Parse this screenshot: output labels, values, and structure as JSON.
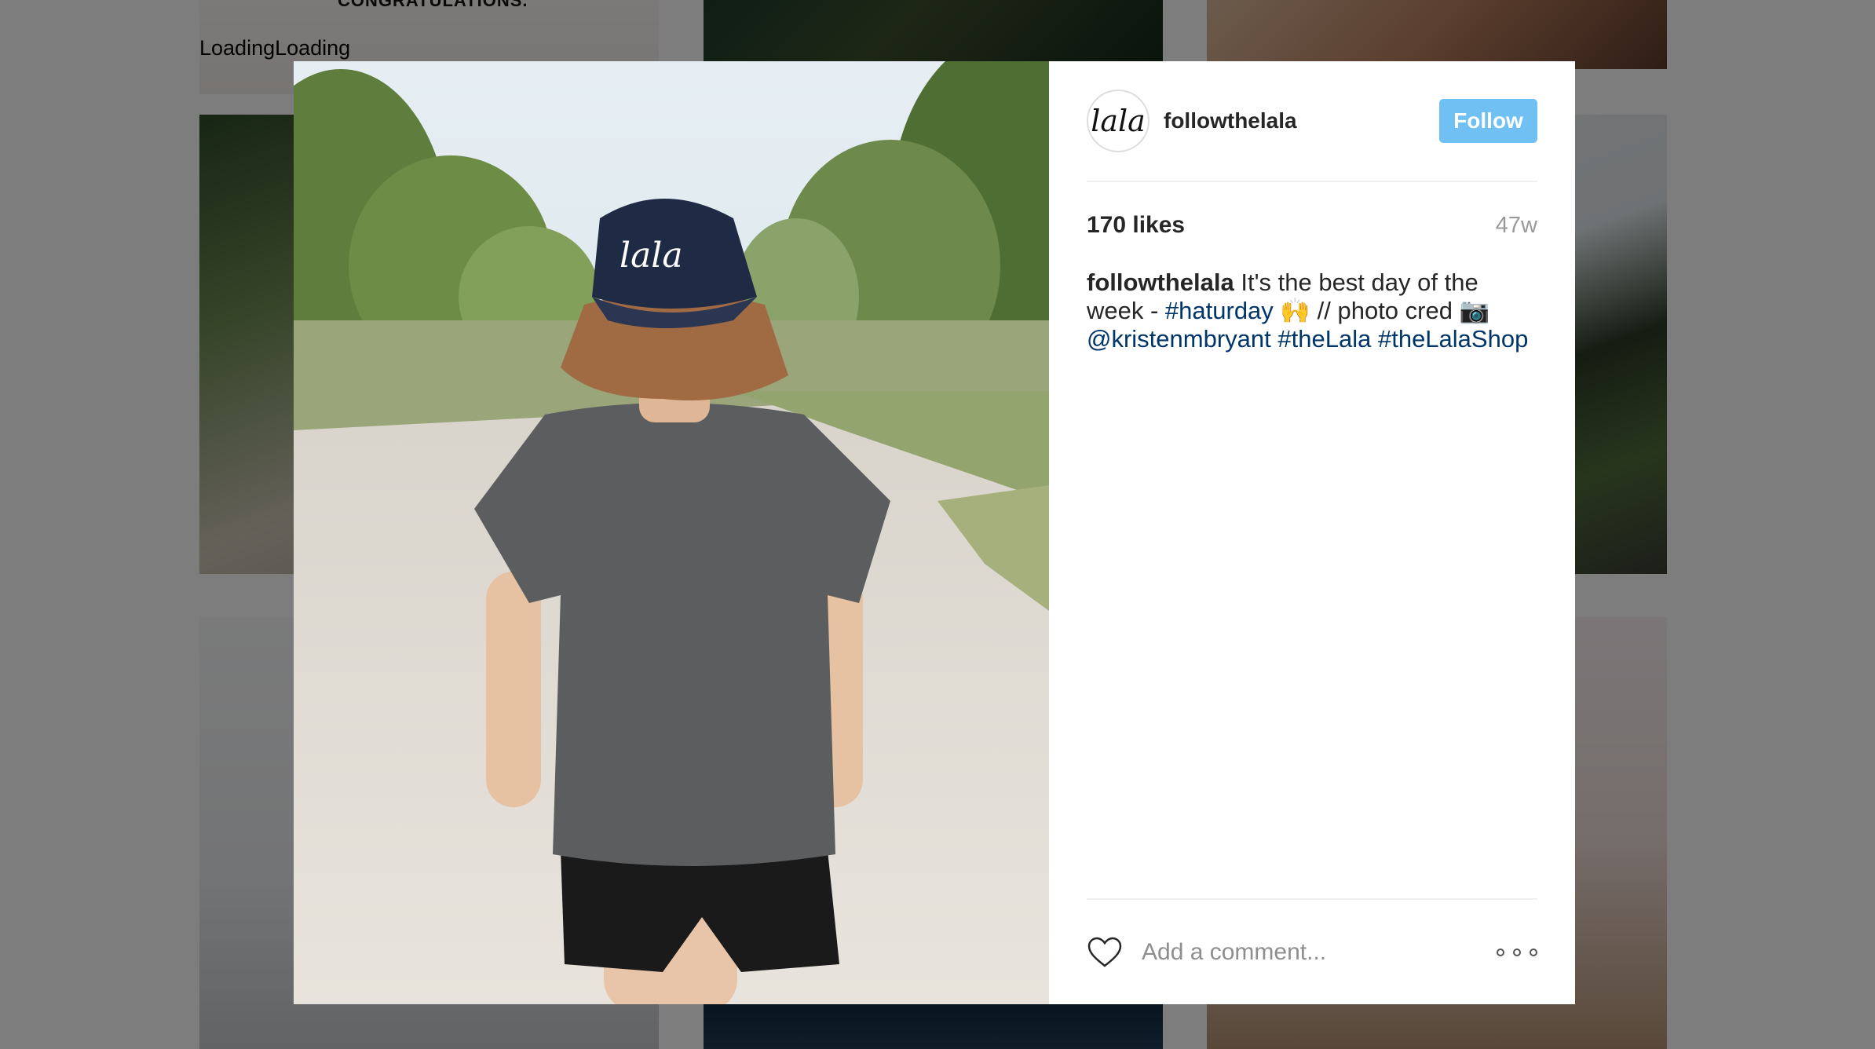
{
  "background": {
    "loading_text": "LoadingLoading",
    "heading_text": "CONGRATULATIONS."
  },
  "post": {
    "username": "followthelala",
    "avatar_text": "lala",
    "follow_label": "Follow",
    "likes": "170 likes",
    "age": "47w",
    "caption": {
      "user": "followthelala",
      "text_1": " It's the best day of the week - ",
      "tag_1": "#haturday",
      "text_2": " 🙌 // photo cred 📷 ",
      "mention": "@kristenmbryant",
      "text_3": " ",
      "tag_2": "#theLala",
      "text_4": " ",
      "tag_3": "#theLalaShop"
    },
    "photo_cap_text": "lala",
    "comment_placeholder": "Add a comment...",
    "colors": {
      "follow": "#70c0f3",
      "hashtag": "#003569"
    },
    "icons": {
      "like": "heart-icon",
      "more": "more-options-icon"
    }
  }
}
